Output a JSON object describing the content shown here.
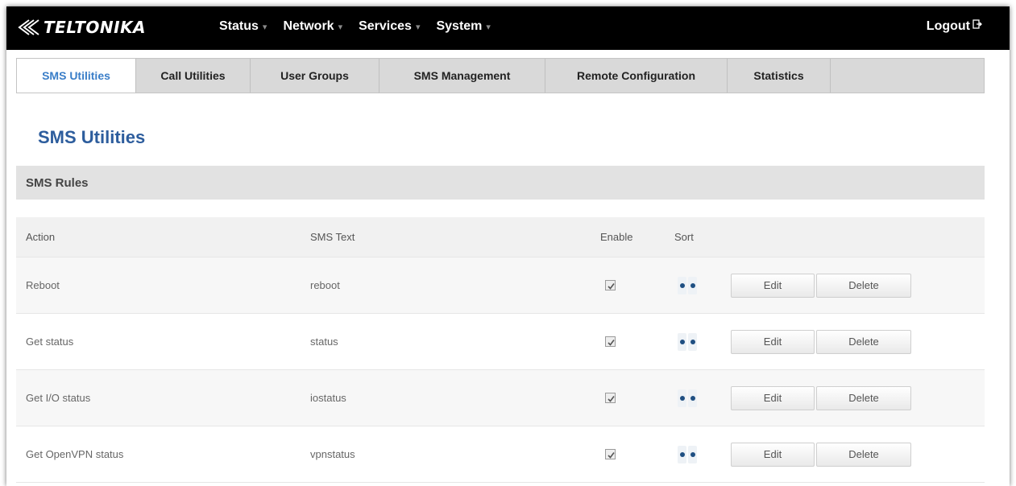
{
  "brand": {
    "name": "TELTONIKA"
  },
  "nav": {
    "items": [
      {
        "label": "Status"
      },
      {
        "label": "Network"
      },
      {
        "label": "Services"
      },
      {
        "label": "System"
      }
    ],
    "logout_label": "Logout"
  },
  "tabs": [
    {
      "label": "SMS Utilities",
      "active": true
    },
    {
      "label": "Call Utilities"
    },
    {
      "label": "User Groups"
    },
    {
      "label": "SMS Management"
    },
    {
      "label": "Remote Configuration"
    },
    {
      "label": "Statistics"
    }
  ],
  "page": {
    "title": "SMS Utilities",
    "section_title": "SMS Rules"
  },
  "table": {
    "headers": {
      "action": "Action",
      "sms_text": "SMS Text",
      "enable": "Enable",
      "sort": "Sort"
    },
    "rows": [
      {
        "action": "Reboot",
        "sms_text": "reboot",
        "enabled": true,
        "edit_label": "Edit",
        "delete_label": "Delete"
      },
      {
        "action": "Get status",
        "sms_text": "status",
        "enabled": true,
        "edit_label": "Edit",
        "delete_label": "Delete"
      },
      {
        "action": "Get I/O status",
        "sms_text": "iostatus",
        "enabled": true,
        "edit_label": "Edit",
        "delete_label": "Delete"
      },
      {
        "action": "Get OpenVPN status",
        "sms_text": "vpnstatus",
        "enabled": true,
        "edit_label": "Edit",
        "delete_label": "Delete"
      }
    ]
  },
  "colors": {
    "topbar": "#000000",
    "active_tab_text": "#3a7ec8",
    "title": "#2d5d9d",
    "sort_dot": "#1f4f82"
  }
}
